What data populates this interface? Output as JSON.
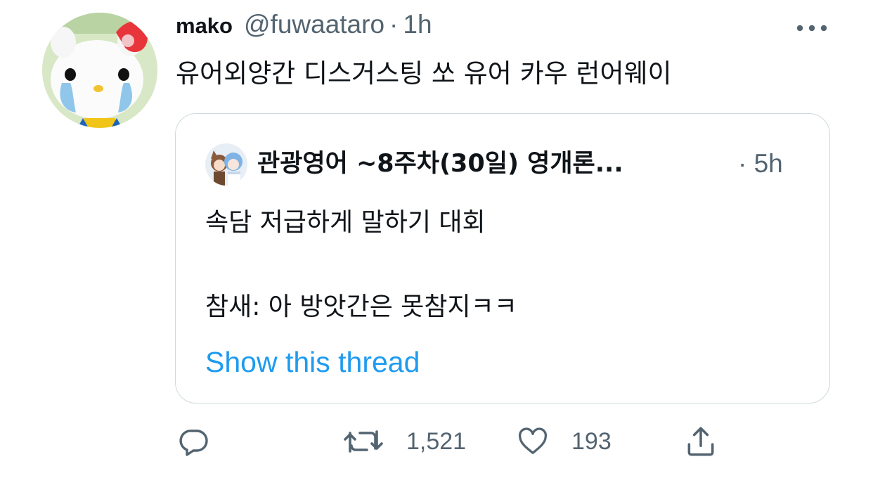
{
  "tweet": {
    "display_name": "mako",
    "handle": "@fuwaataro",
    "separator": "·",
    "time": "1h",
    "text": "유어외양간 디스거스팅 쏘 유어 카우 런어웨이"
  },
  "quoted_tweet": {
    "name": "관광영어 ~8주차(30일) 영개론...",
    "time": "· 5h",
    "line1": "속담 저급하게 말하기 대회",
    "line2": "참새: 아 방앗간은 못참지ㅋㅋ",
    "show_thread": "Show this thread"
  },
  "actions": {
    "reply_icon": "reply-icon",
    "retweet_icon": "retweet-icon",
    "retweet_count": "1,521",
    "like_icon": "heart-icon",
    "like_count": "193",
    "share_icon": "share-icon"
  },
  "colors": {
    "text": "#0f1419",
    "secondary": "#536471",
    "link": "#1d9bf0",
    "border": "#cfd9de"
  }
}
